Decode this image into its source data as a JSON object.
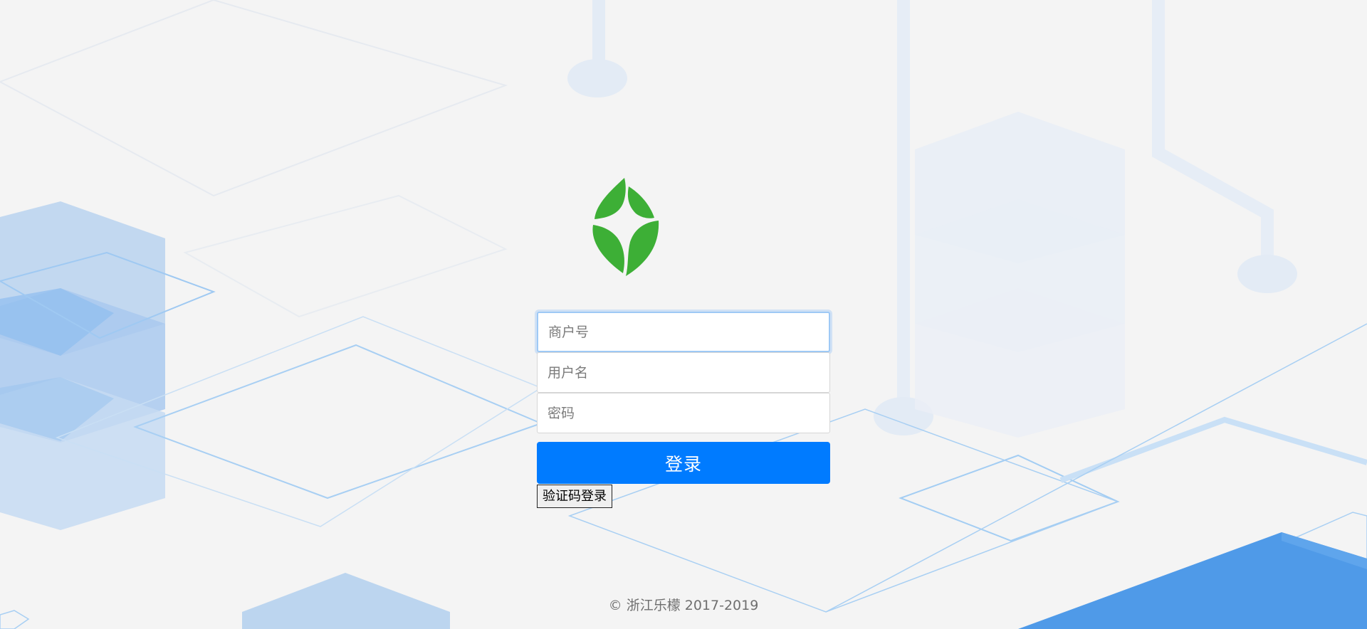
{
  "login": {
    "merchant_placeholder": "商户号",
    "username_placeholder": "用户名",
    "password_placeholder": "密码",
    "login_button": "登录",
    "sms_login_button": "验证码登录"
  },
  "logo": {
    "icon": "green-leaf-logo",
    "color": "#3daf36"
  },
  "footer": {
    "copyright": "© 浙江乐檬 2017-2019"
  },
  "theme": {
    "background": "#f4f4f4",
    "primary": "#007bff",
    "decor_blue": "#5aa0e8"
  }
}
